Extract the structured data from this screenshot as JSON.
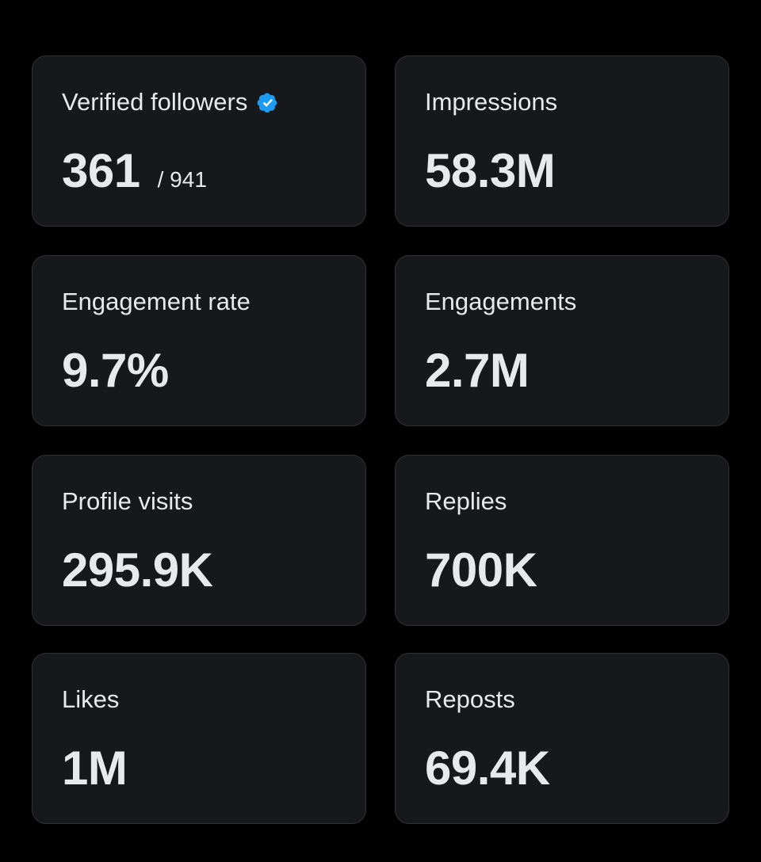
{
  "accent_color": "#1d9bf0",
  "cards": [
    {
      "label": "Verified followers",
      "value": "361",
      "total": "/ 941",
      "icon": "verified-badge-icon"
    },
    {
      "label": "Impressions",
      "value": "58.3M"
    },
    {
      "label": "Engagement rate",
      "value": "9.7%"
    },
    {
      "label": "Engagements",
      "value": "2.7M"
    },
    {
      "label": "Profile visits",
      "value": "295.9K"
    },
    {
      "label": "Replies",
      "value": "700K"
    },
    {
      "label": "Likes",
      "value": "1M"
    },
    {
      "label": "Reposts",
      "value": "69.4K"
    }
  ]
}
